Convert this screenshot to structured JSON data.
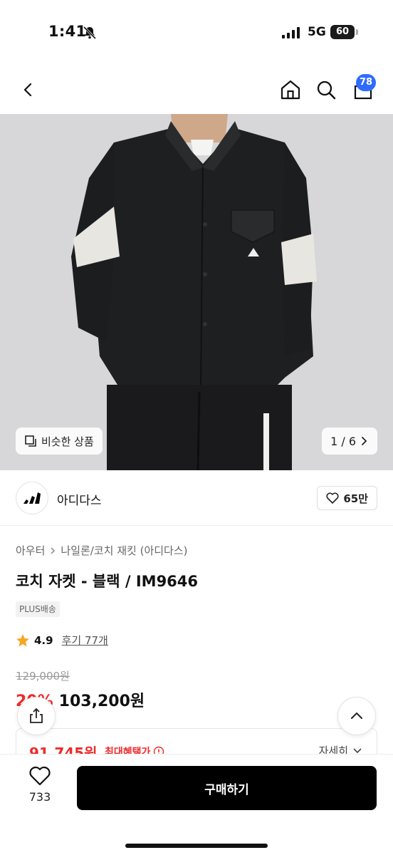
{
  "status": {
    "time": "1:41",
    "network": "5G",
    "battery": "60"
  },
  "header": {
    "cart_count": "78"
  },
  "gallery": {
    "similar_label": "비슷한 상품",
    "pager": "1 / 6"
  },
  "brand": {
    "name": "아디다스",
    "likes": "65만"
  },
  "product": {
    "breadcrumb": [
      "아우터",
      "나일론/코치 재킷 (아디다스)"
    ],
    "title": "코치 자켓 - 블랙 / IM9646",
    "tag": "PLUS배송",
    "rating": "4.9",
    "reviews": "후기 77개",
    "original_price": "129,000원",
    "discount": "20%",
    "price": "103,200원",
    "benefit_price": "91,745원",
    "benefit_label": "최대혜택가",
    "benefit_detail": "자세히"
  },
  "bottom": {
    "wish_count": "733",
    "buy_label": "구매하기"
  },
  "colors": {
    "accent": "#ef2a2a",
    "badge": "#2f6bff",
    "buy": "#000000"
  }
}
